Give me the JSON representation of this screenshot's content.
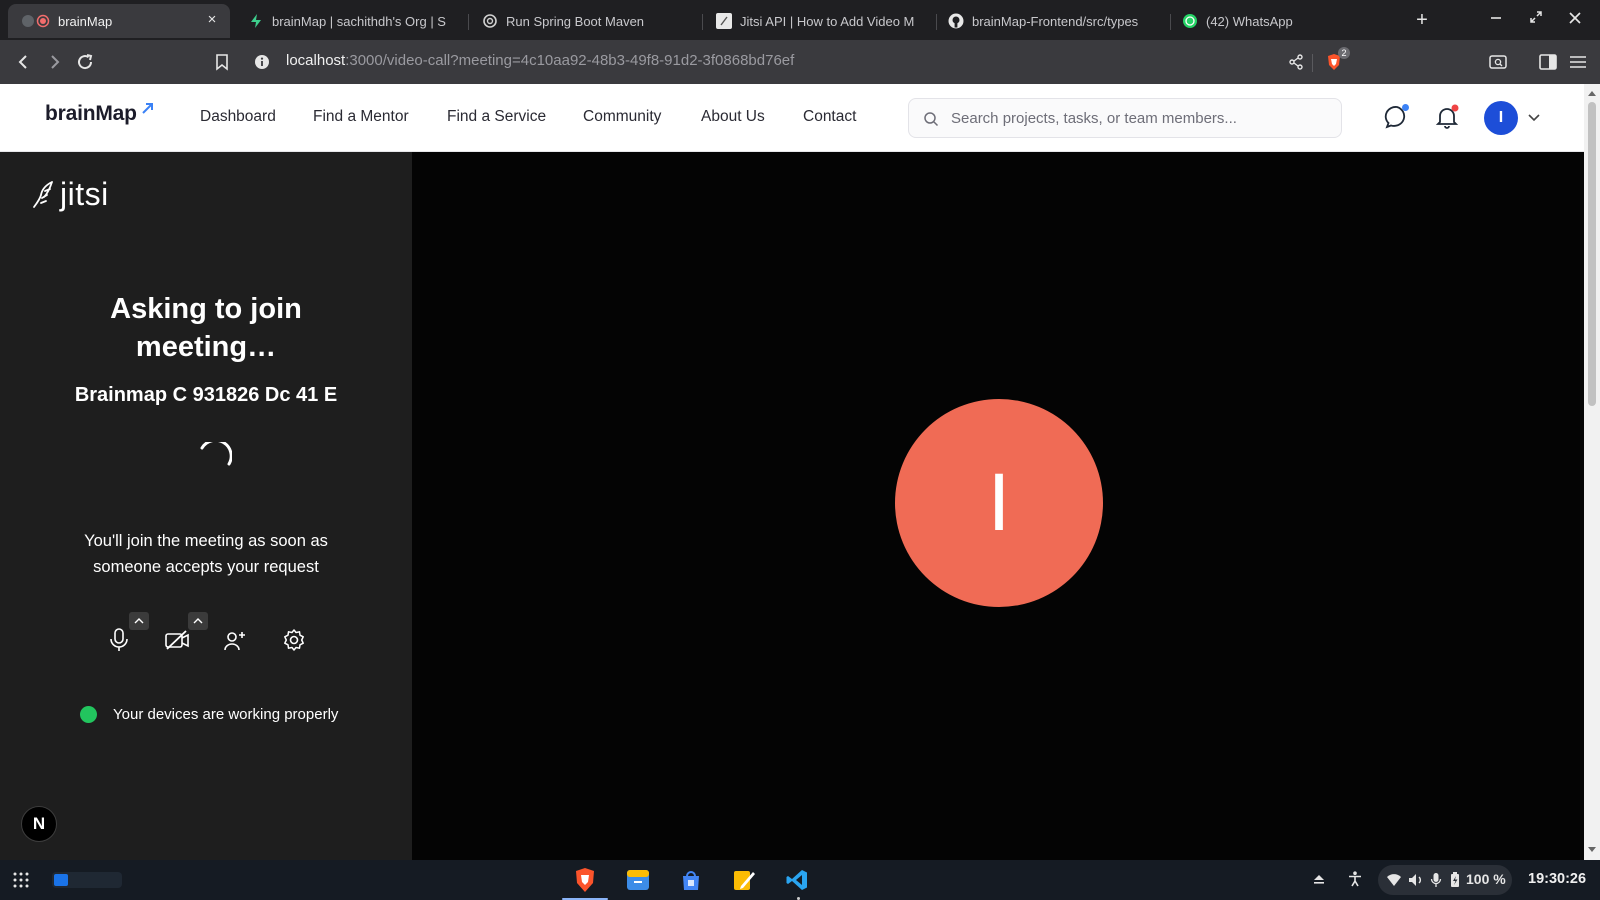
{
  "browser": {
    "tabs": [
      {
        "title": "brainMap",
        "active": true,
        "favicon": "brainmap-record-icon"
      },
      {
        "title": "brainMap | sachithdh's Org | S",
        "active": false,
        "favicon": "supabase-icon"
      },
      {
        "title": "Run Spring Boot Maven",
        "active": false,
        "favicon": "chatgpt-icon"
      },
      {
        "title": "Jitsi API | How to Add Video M",
        "active": false,
        "favicon": "jitsi-icon"
      },
      {
        "title": "brainMap-Frontend/src/types",
        "active": false,
        "favicon": "github-icon"
      },
      {
        "title": "(42) WhatsApp",
        "active": false,
        "favicon": "whatsapp-icon"
      }
    ],
    "new_tab_label": "+",
    "close_tab_label": "×",
    "url": {
      "host": "localhost",
      "rest": ":3000/video-call?meeting=4c10aa92-48b3-49f8-91d2-3f0868bd76ef"
    },
    "brave_shield_count": "2"
  },
  "header": {
    "brand": "brainMap",
    "nav": [
      "Dashboard",
      "Find a Mentor",
      "Find a Service",
      "Community",
      "About Us",
      "Contact"
    ],
    "search_placeholder": "Search projects, tasks, or team members...",
    "avatar_initial": "I"
  },
  "jitsi": {
    "logo_text": "jitsi",
    "title": "Asking to join meeting…",
    "meeting_name": "Brainmap C 931826 Dc 41 E",
    "join_note": "You'll join the meeting as soon as someone accepts your request",
    "device_status": "Your devices are working properly",
    "n_badge": "N",
    "participant_initial": "I",
    "participant_color": "#f06b55",
    "status_color": "#22c55e"
  },
  "shelf": {
    "apps": [
      "brave-icon",
      "files-icon",
      "play-store-icon",
      "notes-icon",
      "vscode-icon"
    ],
    "battery": "100 %",
    "time": "19:30:26"
  }
}
